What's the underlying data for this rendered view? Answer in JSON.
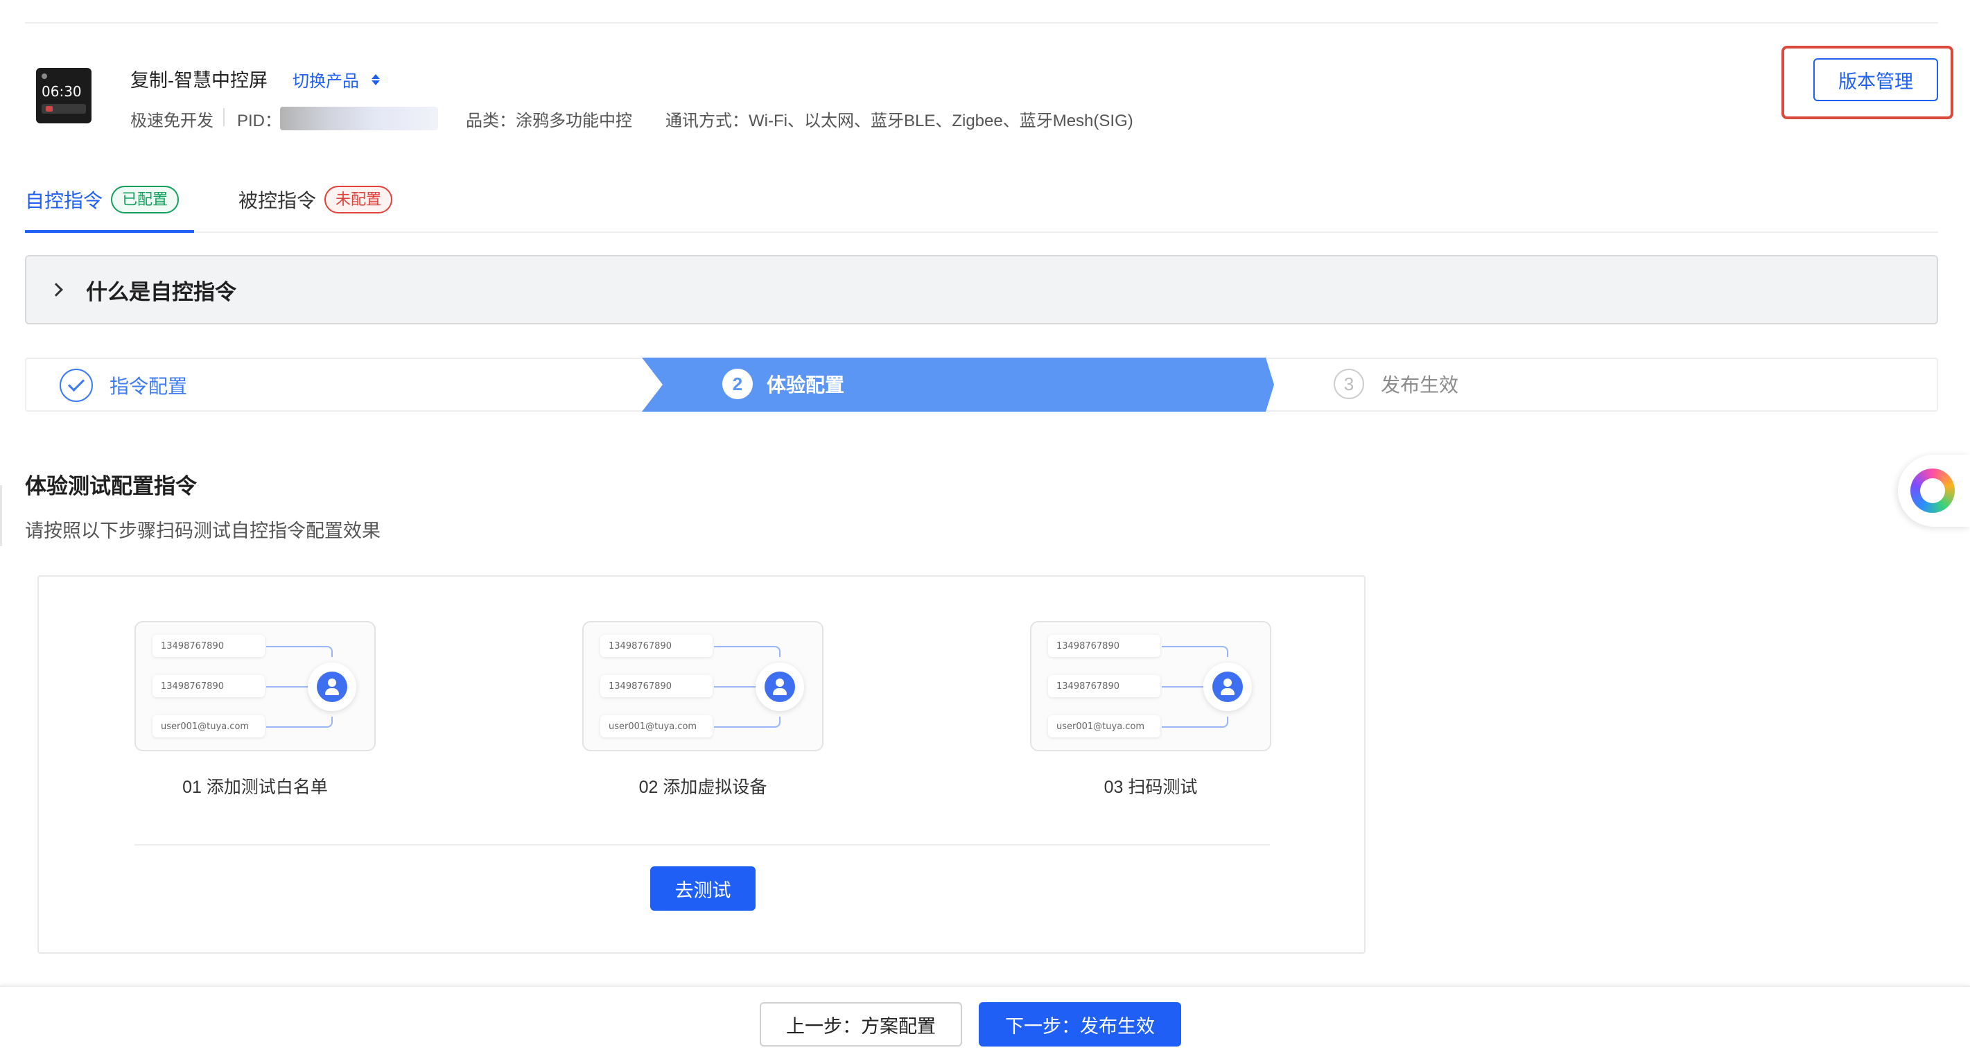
{
  "product": {
    "thumb_time": "06:30",
    "name": "复制-智慧中控屏",
    "switch_label": "切换产品",
    "dev_mode": "极速免开发",
    "pid_label": "PID：",
    "category": "品类：涂鸦多功能中控",
    "protocols": "通讯方式：Wi-Fi、以太网、蓝牙BLE、Zigbee、蓝牙Mesh(SIG)"
  },
  "header": {
    "version_button": "版本管理"
  },
  "tabs": [
    {
      "label": "自控指令",
      "badge": "已配置"
    },
    {
      "label": "被控指令",
      "badge": "未配置"
    }
  ],
  "collapse": {
    "title": "什么是自控指令"
  },
  "steps": [
    {
      "label": "指令配置",
      "status": "done"
    },
    {
      "number": "2",
      "label": "体验配置",
      "status": "current"
    },
    {
      "number": "3",
      "label": "发布生效",
      "status": "wait"
    }
  ],
  "section": {
    "title": "体验测试配置指令",
    "subtitle": "请按照以下步骤扫码测试自控指令配置效果"
  },
  "illustration": {
    "entries": [
      "13498767890",
      "13498767890",
      "user001@tuya.com"
    ]
  },
  "guide_steps": [
    {
      "caption": "01 添加测试白名单"
    },
    {
      "caption": "02 添加虚拟设备"
    },
    {
      "caption": "03 扫码测试"
    }
  ],
  "test_button": "去测试",
  "footer": {
    "prev": "上一步：方案配置",
    "next": "下一步：发布生效"
  },
  "colors": {
    "primary": "#1f5ff5",
    "step_active": "#5b96f5",
    "success": "#12a05c",
    "danger": "#e0423a",
    "highlight": "#d94a3d"
  }
}
